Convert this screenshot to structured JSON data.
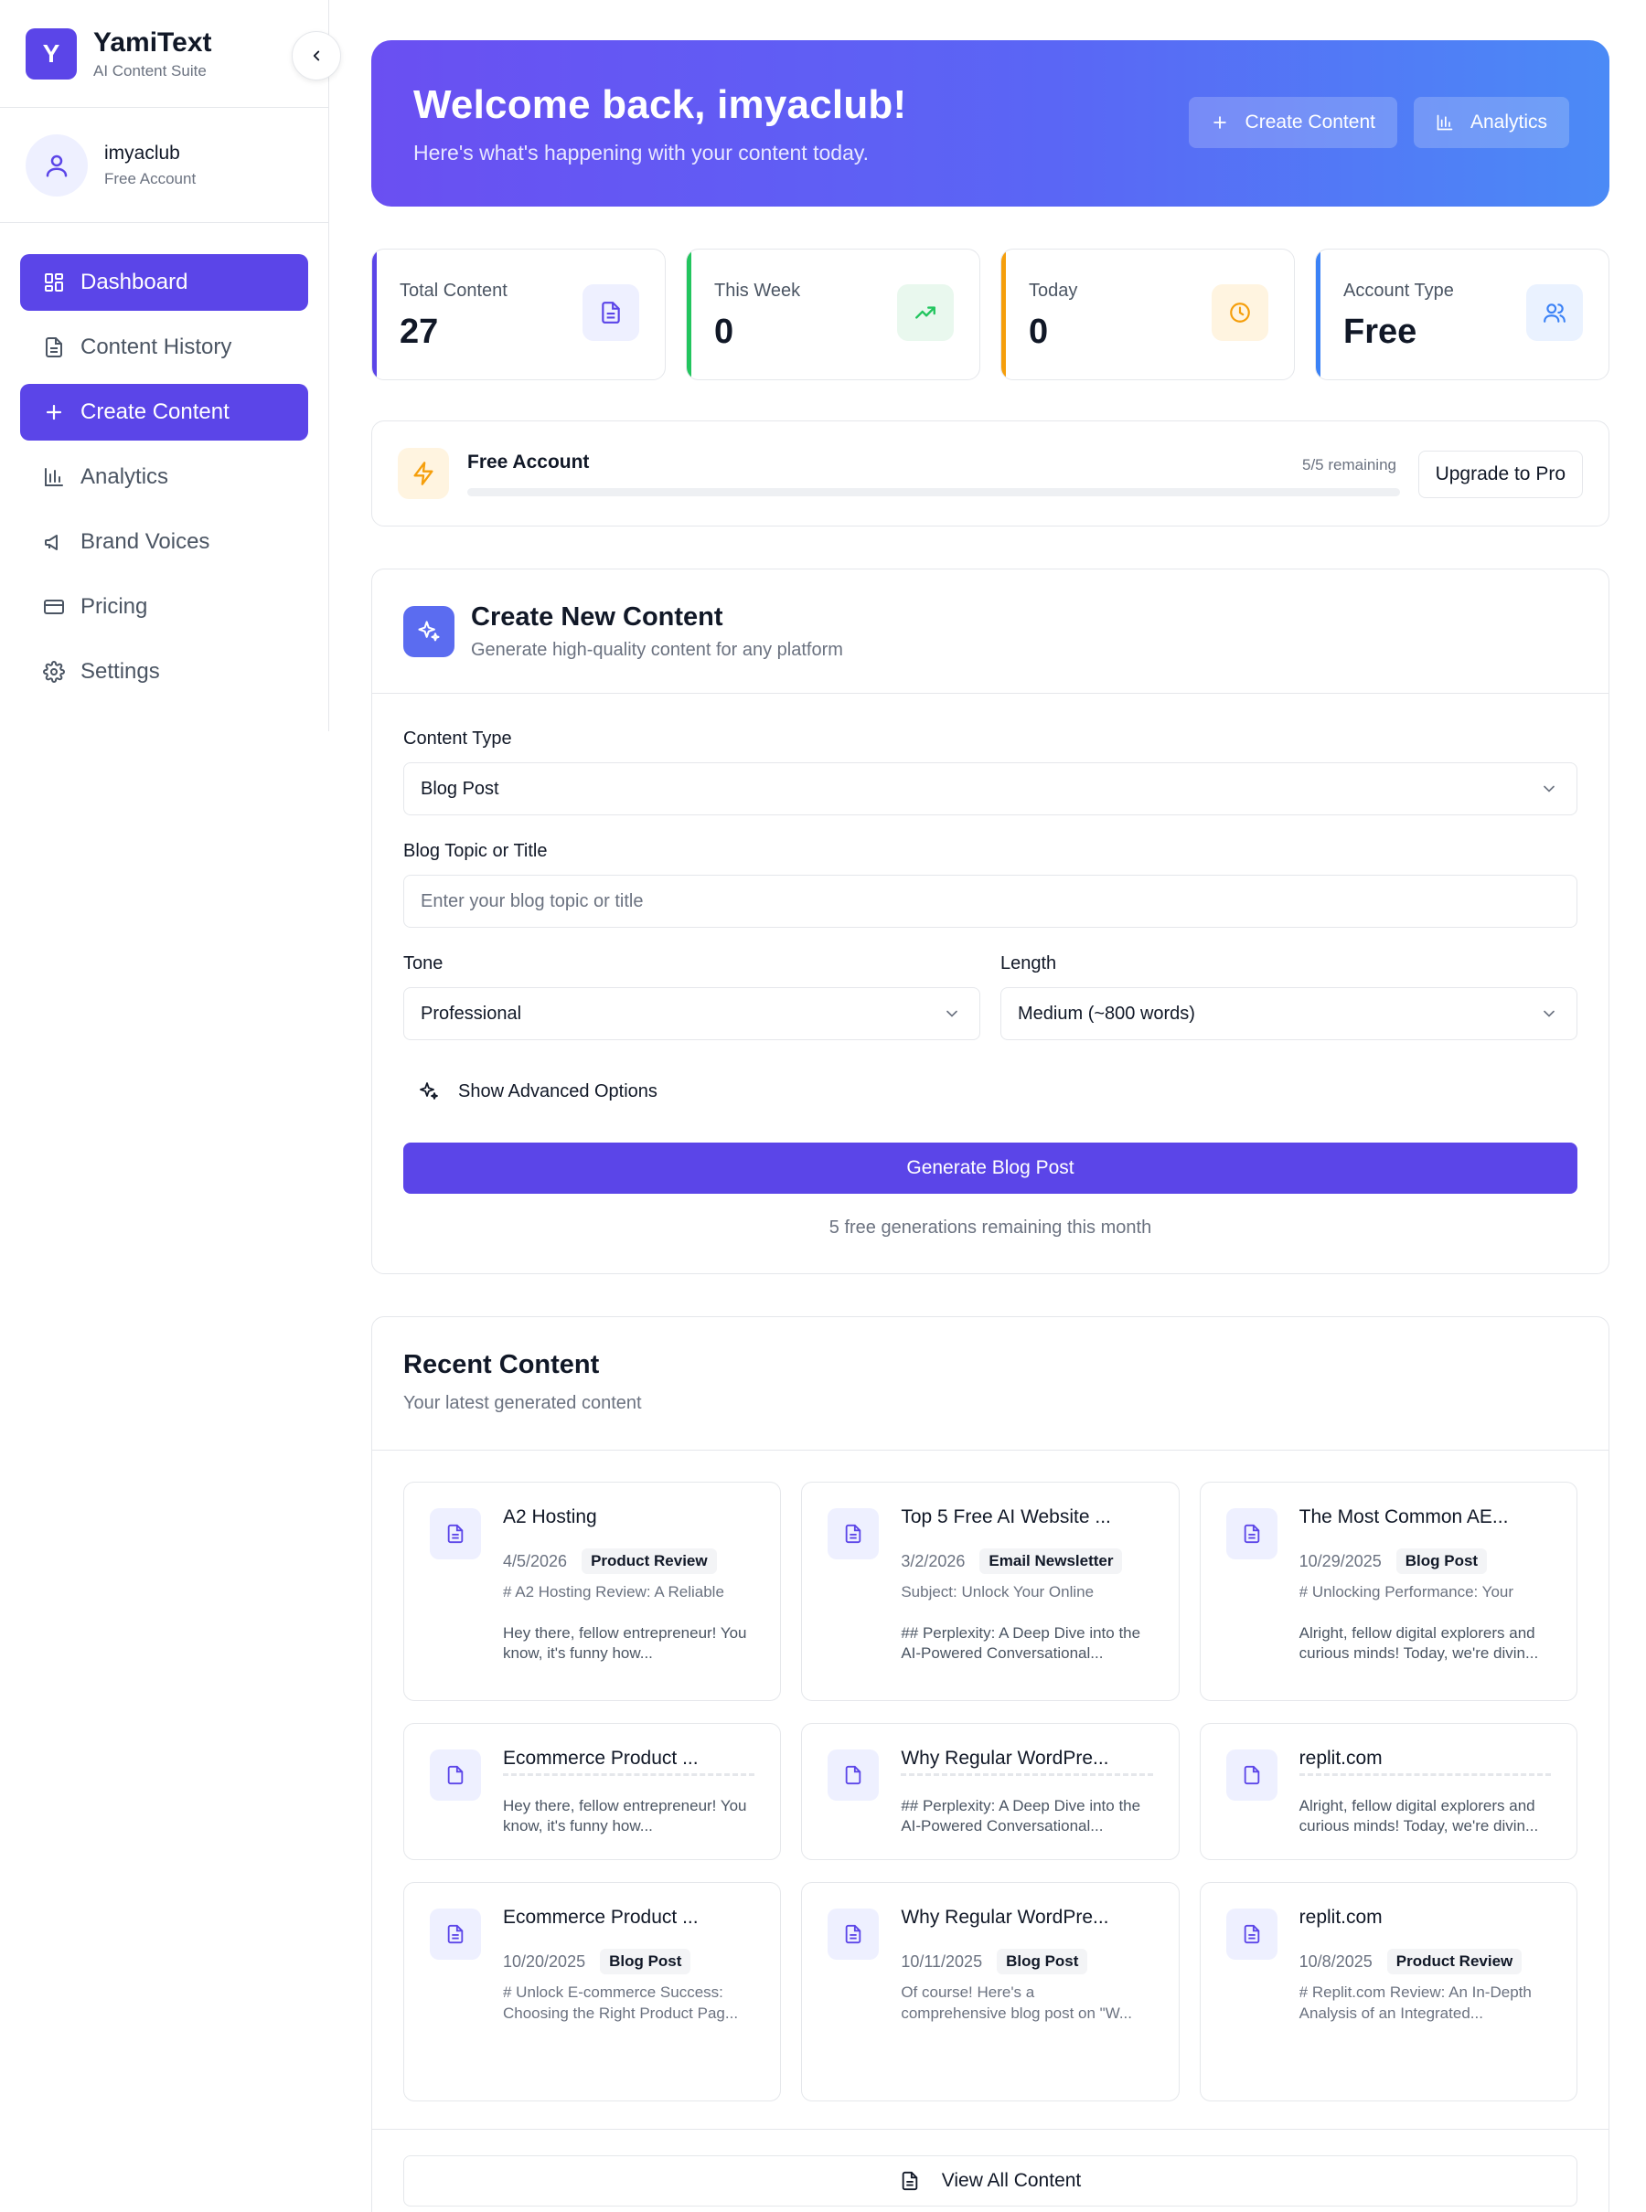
{
  "brand": {
    "logo_letter": "Y",
    "name": "YamiText",
    "subtitle": "AI Content Suite"
  },
  "user": {
    "name": "imyaclub",
    "plan": "Free Account"
  },
  "sidebar": {
    "items": [
      {
        "label": "Dashboard",
        "icon": "dashboard-icon",
        "active": true
      },
      {
        "label": "Content History",
        "icon": "document-icon",
        "active": false
      },
      {
        "label": "Create Content",
        "icon": "plus-icon",
        "active": true
      },
      {
        "label": "Analytics",
        "icon": "bar-chart-icon",
        "active": false
      },
      {
        "label": "Brand Voices",
        "icon": "megaphone-icon",
        "active": false
      },
      {
        "label": "Pricing",
        "icon": "credit-card-icon",
        "active": false
      },
      {
        "label": "Settings",
        "icon": "gear-icon",
        "active": false
      }
    ]
  },
  "hero": {
    "title": "Welcome back, imyaclub!",
    "subtitle": "Here's what's happening with your content today.",
    "create_label": "Create Content",
    "analytics_label": "Analytics"
  },
  "stats": [
    {
      "label": "Total Content",
      "value": "27",
      "accent": "#5b45e8",
      "icon": "document-icon"
    },
    {
      "label": "This Week",
      "value": "0",
      "accent": "#22c55e",
      "icon": "trending-up-icon"
    },
    {
      "label": "Today",
      "value": "0",
      "accent": "#f59e0b",
      "icon": "clock-icon"
    },
    {
      "label": "Account Type",
      "value": "Free",
      "accent": "#3b82f6",
      "icon": "users-icon"
    }
  ],
  "quota": {
    "title": "Free Account",
    "remaining": "5/5 remaining",
    "upgrade_label": "Upgrade to Pro",
    "used_fraction": 0
  },
  "create": {
    "title": "Create New Content",
    "subtitle": "Generate high-quality content for any platform",
    "content_type_label": "Content Type",
    "content_type_value": "Blog Post",
    "topic_label": "Blog Topic or Title",
    "topic_placeholder": "Enter your blog topic or title",
    "tone_label": "Tone",
    "tone_value": "Professional",
    "length_label": "Length",
    "length_value": "Medium (~800 words)",
    "advanced_label": "Show Advanced Options",
    "generate_label": "Generate Blog Post",
    "note": "5 free generations remaining this month"
  },
  "recent": {
    "title": "Recent Content",
    "subtitle": "Your latest generated content",
    "items": [
      {
        "title": "A2 Hosting",
        "date": "4/5/2026",
        "tag": "Product Review",
        "heading": "# A2 Hosting Review: A Reliable",
        "excerpt": "Hey there, fellow entrepreneur! You know, it's funny how..."
      },
      {
        "title": "Top 5 Free AI Website ...",
        "date": "3/2/2026",
        "tag": "Email Newsletter",
        "heading": "Subject: Unlock Your Online",
        "excerpt": "## Perplexity: A Deep Dive into the AI-Powered Conversational..."
      },
      {
        "title": "The Most Common AE...",
        "date": "10/29/2025",
        "tag": "Blog Post",
        "heading": "# Unlocking Performance: Your",
        "excerpt": "Alright, fellow digital explorers and curious minds! Today, we're divin..."
      },
      {
        "title": "Ecommerce Product ...",
        "excerpt": "Hey there, fellow entrepreneur! You know, it's funny how..."
      },
      {
        "title": "Why Regular WordPre...",
        "excerpt": "## Perplexity: A Deep Dive into the AI-Powered Conversational..."
      },
      {
        "title": "replit.com",
        "excerpt": "Alright, fellow digital explorers and curious minds! Today, we're divin..."
      },
      {
        "title": "Ecommerce Product ...",
        "date": "10/20/2025",
        "tag": "Blog Post",
        "heading": "# Unlock E-commerce Success:",
        "excerpt": "Choosing the Right Product Pag..."
      },
      {
        "title": "Why Regular WordPre...",
        "date": "10/11/2025",
        "tag": "Blog Post",
        "heading": "Of course! Here's a",
        "excerpt": "comprehensive blog post on \"W..."
      },
      {
        "title": "replit.com",
        "date": "10/8/2025",
        "tag": "Product Review",
        "heading": "# Replit.com Review: An In-Depth",
        "excerpt": "Analysis of an Integrated..."
      }
    ],
    "view_all_label": "View All Content"
  }
}
